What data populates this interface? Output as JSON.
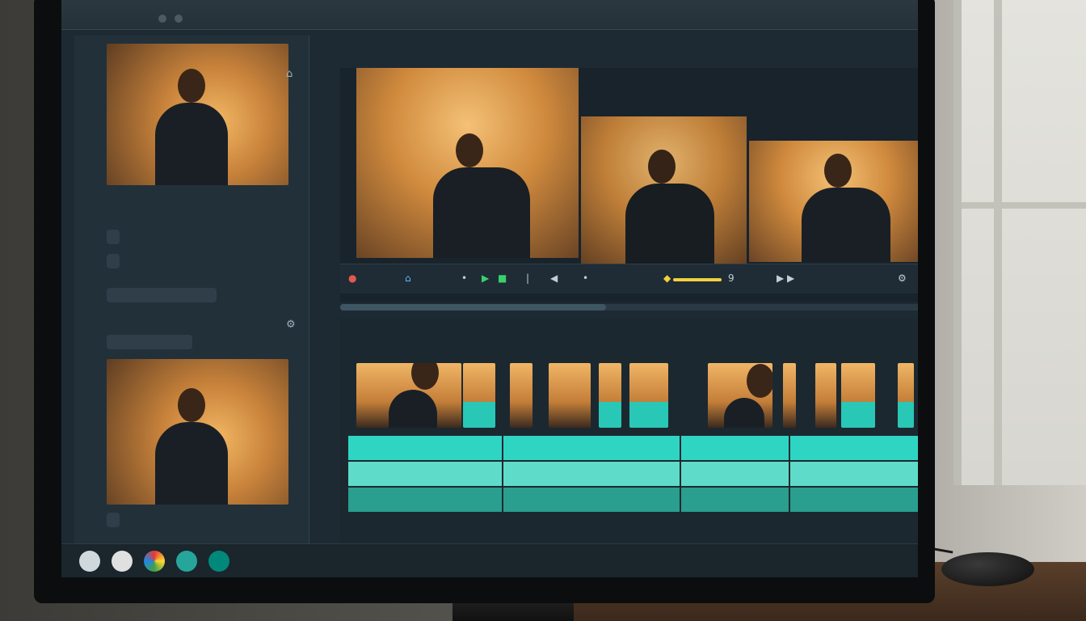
{
  "app": {
    "title_top": "",
    "preview_header": "",
    "timeline_header": ""
  },
  "left_panel": {
    "clips": [
      {
        "label": ""
      },
      {
        "label": ""
      }
    ],
    "pills": [
      {
        "label": ""
      },
      {
        "label": ""
      },
      {
        "label": ""
      }
    ]
  },
  "preview": {
    "controls": {
      "rewind": "●",
      "home": "⌂",
      "dot_a": "•",
      "dot_b": "•",
      "play": "▶",
      "stop": "■",
      "bar": "|",
      "speaker": "◀",
      "volume_value": "",
      "marker": "◆",
      "nine": "9",
      "pair": "▶ ▶",
      "settings": "⚙"
    }
  },
  "timeline": {
    "tracks": [
      {
        "name": ""
      },
      {
        "name": ""
      },
      {
        "name": ""
      }
    ]
  },
  "colors": {
    "teal": "#2fd5c3",
    "accent_green": "#38d16a",
    "accent_yellow": "#f2d23c",
    "panel_bg": "#1e2a33"
  },
  "icons": {
    "dock": [
      "app-icon",
      "record-icon",
      "color-icon",
      "cut-icon",
      "export-icon"
    ]
  }
}
